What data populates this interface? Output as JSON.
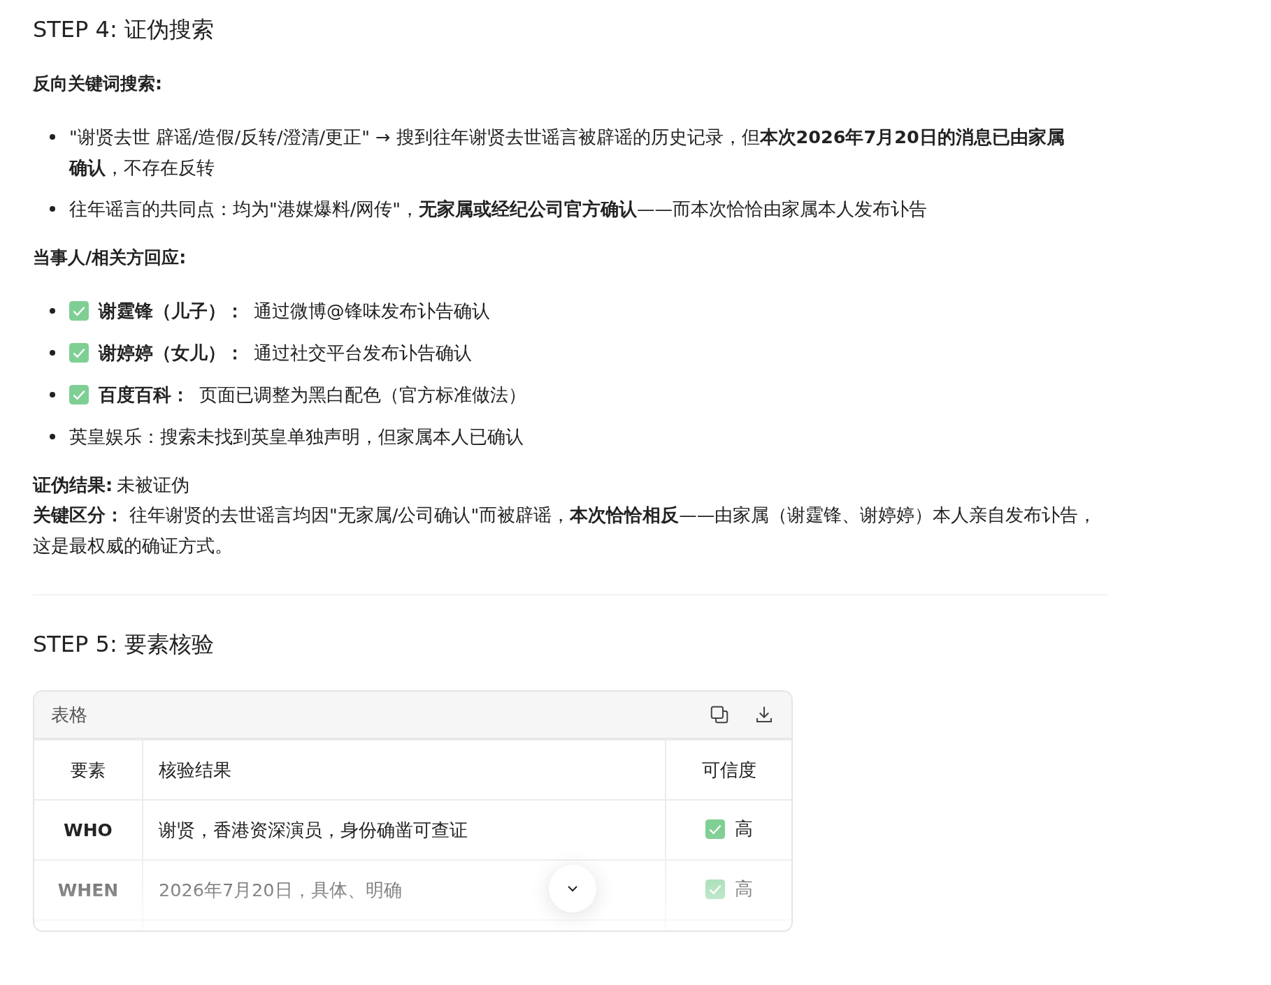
{
  "step4": {
    "title": "STEP 4: 证伪搜索",
    "reverse_search": {
      "heading": "反向关键词搜索:",
      "items": [
        {
          "text": "\"谢贤去世 辟谣/造假/反转/澄清/更正\" → 搜到往年谢贤去世谣言被辟谣的历史记录，但**本次2026年7月20日的消息已由家属确认**，不存在反转"
        },
        {
          "text": "往年谣言的共同点：均为\"港媒爆料/网传\"，**无家属或经纪公司官方确认**——而本次恰恰由家属本人发布讣告"
        }
      ]
    },
    "responses": {
      "heading": "当事人/相关方回应:",
      "items": [
        {
          "verified": true,
          "label": "谢霆锋（儿子）：",
          "text": "通过微博@锋味发布讣告确认"
        },
        {
          "verified": true,
          "label": "谢婷婷（女儿）：",
          "text": "通过社交平台发布讣告确认"
        },
        {
          "verified": true,
          "label": "百度百科：",
          "text": "页面已调整为黑白配色（官方标准做法）"
        },
        {
          "verified": false,
          "text": "英皇娱乐：搜索未找到英皇单独声明，但家属本人已确认"
        }
      ]
    },
    "result": {
      "label": "证伪结果:",
      "value": "未被证伪"
    },
    "distinction": {
      "text": "**关键区分：**  往年谢贤的去世谣言均因\"无家属/公司确认\"而被辟谣，**本次恰恰相反**——由家属（谢霆锋、谢婷婷）本人亲自发布讣告，这是最权威的确证方式。"
    }
  },
  "step5": {
    "title": "STEP 5: 要素核验",
    "table": {
      "caption": "表格",
      "columns": [
        "要素",
        "核验结果",
        "可信度"
      ],
      "rows": [
        {
          "element": "WHO",
          "result": "谢贤，香港资深演员，身份确凿可查证",
          "verified": true,
          "credibility": "高"
        },
        {
          "element": "WHEN",
          "result": "2026年7月20日，具体、明确",
          "verified": true,
          "credibility": "高"
        }
      ]
    }
  }
}
